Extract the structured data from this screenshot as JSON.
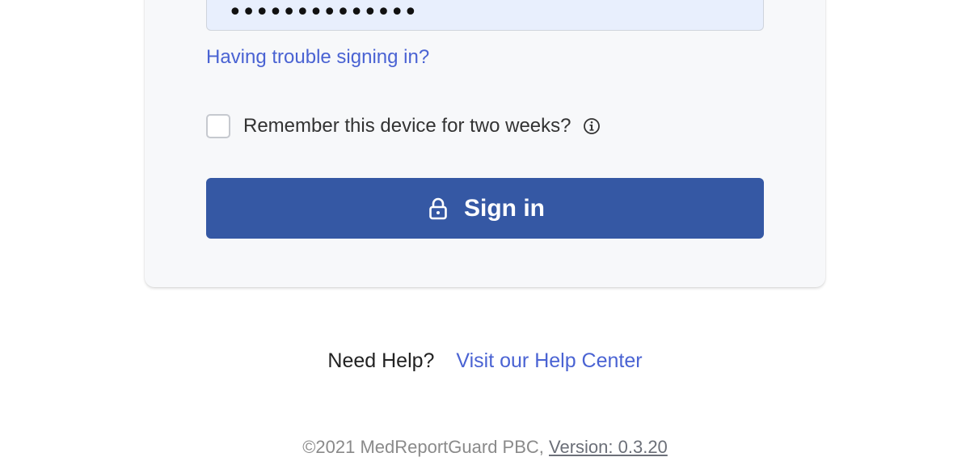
{
  "form": {
    "password_mask": "••••••••••••••",
    "trouble_link": "Having trouble signing in?",
    "remember_label": "Remember this device for two weeks?",
    "remember_checked": false,
    "signin_label": "Sign in",
    "info_icon": "info-circle-icon",
    "lock_icon": "lock-icon"
  },
  "help": {
    "prompt": "Need Help?",
    "link": "Visit our Help Center"
  },
  "footer": {
    "copyright": "©2021 MedReportGuard PBC,",
    "version": "Version: 0.3.20"
  },
  "colors": {
    "accent": "#3558a4",
    "link": "#4a63d3",
    "field_bg": "#e8effd",
    "card_bg": "#f7f8fa"
  }
}
